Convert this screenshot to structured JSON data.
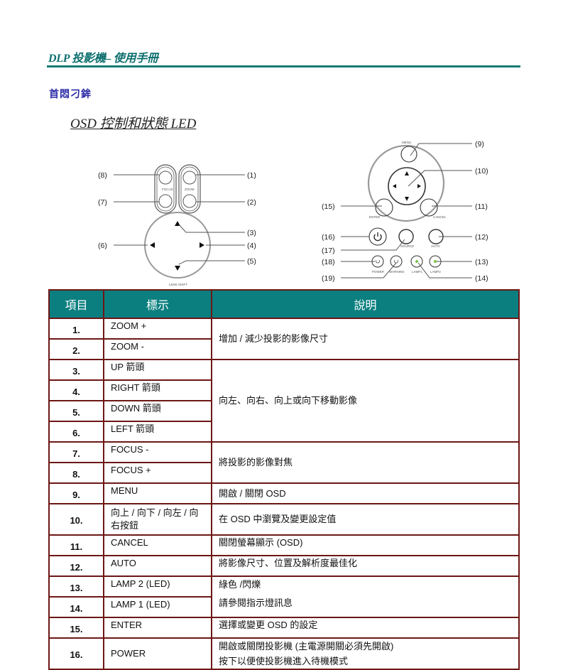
{
  "header": {
    "title": "DLP 投影機– 使用手冊",
    "accent_color": "#177a76"
  },
  "section_title": "首悶刁鉾",
  "sub_title": "OSD 控制和狀態 LED",
  "diagram_left": {
    "callouts": [
      "(8)",
      "(7)",
      "(6)",
      "(1)",
      "(2)",
      "(3)",
      "(4)",
      "(5)"
    ],
    "focus_label": "FOCUS",
    "zoom_label": "ZOOM",
    "lens_shift_label": "LENS SHIFT"
  },
  "diagram_right": {
    "callouts_left": [
      "(15)",
      "(16)",
      "(17)",
      "(18)",
      "(19)"
    ],
    "callouts_right": [
      "(9)",
      "(10)",
      "(11)",
      "(12)",
      "(13)",
      "(14)"
    ],
    "labels": {
      "menu": "MENU",
      "enter": "ENTER",
      "cancel": "CANCEL",
      "source": "SOURCE",
      "auto": "AUTO",
      "power": "POWER",
      "warning": "WARNING",
      "lamp1": "LAMP1",
      "lamp2": "LAMP2"
    },
    "led_color": "#7cc24a"
  },
  "table": {
    "header_color": "#0b7f7f",
    "border_color": "#6e1616",
    "columns": [
      "項目",
      "標示",
      "說明"
    ],
    "rows": [
      {
        "num": "1.",
        "label": "ZOOM +"
      },
      {
        "num": "2.",
        "label": "ZOOM -"
      },
      {
        "num": "3.",
        "label": "UP 箭頭"
      },
      {
        "num": "4.",
        "label": "RIGHT 箭頭"
      },
      {
        "num": "5.",
        "label": "DOWN 箭頭"
      },
      {
        "num": "6.",
        "label": "LEFT 箭頭"
      },
      {
        "num": "7.",
        "label": "FOCUS -"
      },
      {
        "num": "8.",
        "label": "FOCUS +"
      },
      {
        "num": "9.",
        "label": "MENU"
      },
      {
        "num": "10.",
        "label": "向上 / 向下 / 向左 / 向右按鈕"
      },
      {
        "num": "11.",
        "label": "CANCEL"
      },
      {
        "num": "12.",
        "label": "AUTO"
      },
      {
        "num": "13.",
        "label": "LAMP 2 (LED)"
      },
      {
        "num": "14.",
        "label": "LAMP 1 (LED)"
      },
      {
        "num": "15.",
        "label": "ENTER"
      },
      {
        "num": "16.",
        "label": "POWER"
      }
    ],
    "descriptions": {
      "zoom": "增加 / 減少投影的影像尺寸",
      "arrows": "向左、向右、向上或向下移動影像",
      "focus": "將投影的影像對焦",
      "menu": "開啟 / 關閉 OSD",
      "nav": "在 OSD 中瀏覽及變更設定值",
      "cancel": "關閉螢幕顯示 (OSD)",
      "auto": "將影像尺寸、位置及解析度最佳化",
      "lamp_line1": "綠色 /閃爍",
      "lamp_line2": "請參閱指示燈訊息",
      "enter": "選擇或變更 OSD 的設定",
      "power_line1": "開啟或關閉投影機 (主電源開關必須先開啟)",
      "power_line2": "按下以便使投影機進入待機模式"
    }
  }
}
